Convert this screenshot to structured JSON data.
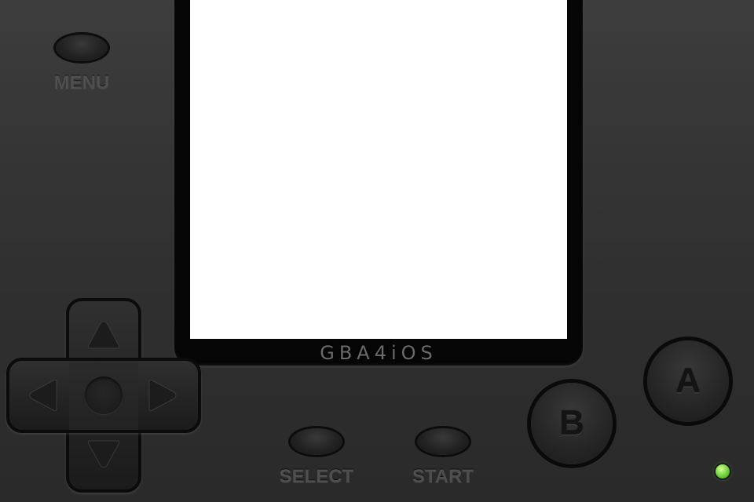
{
  "brand": "GBA4iOS",
  "buttons": {
    "menu": "MENU",
    "select": "SELECT",
    "start": "START",
    "a": "A",
    "b": "B"
  },
  "dpad": {
    "up": "up-arrow-icon",
    "down": "down-arrow-icon",
    "left": "left-arrow-icon",
    "right": "right-arrow-icon"
  },
  "colors": {
    "body": "#2f2f2f",
    "screen": "#ffffff",
    "bezel": "#050505",
    "led": "#82e04a"
  }
}
